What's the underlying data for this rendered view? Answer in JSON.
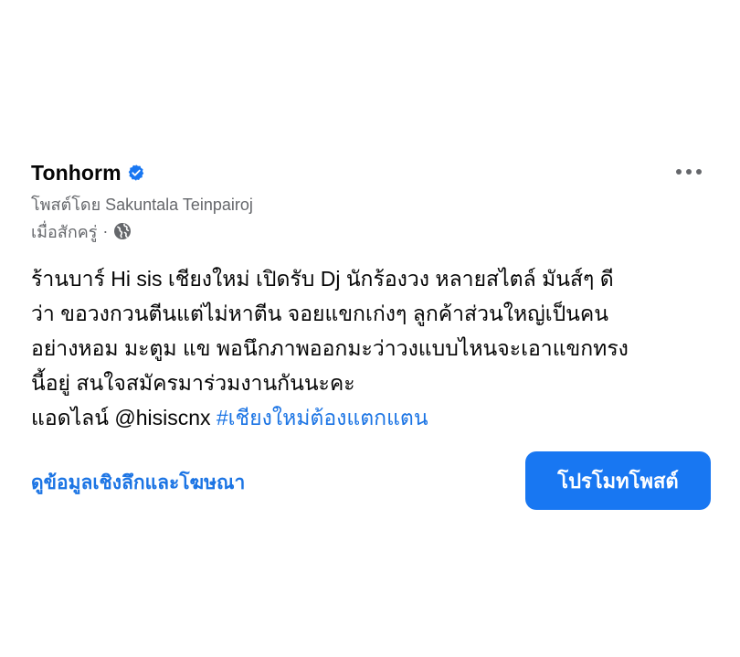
{
  "post": {
    "page_name": "Tonhorm",
    "byline": "โพสต์โดย Sakuntala Teinpairoj",
    "timestamp": "เมื่อสักครู่",
    "separator": "·",
    "body_lines": [
      "ร้านบาร์ Hi sis เชียงใหม่ เปิดรับ Dj  นักร้องวง หลายสไตล์ มันส์ๆ ดี",
      "ว่า  ขอวงกวนตีนแต่ไม่หาตีน จอยแขกเก่งๆ ลูกค้าส่วนใหญ่เป็นคน",
      "อย่างหอม มะตูม แข พอนึกภาพออกมะว่าวงแบบไหนจะเอาแขกทรง",
      "นี้อยู่ สนใจสมัครมาร่วมงานกันนะคะ"
    ],
    "contact_prefix": "แอดไลน์ @hisiscnx ",
    "hashtag": "#เชียงใหม่ต้องแตกแตน"
  },
  "footer": {
    "insights_label": "ดูข้อมูลเชิงลึกและโฆษณา",
    "promote_label": "โปรโมทโพสต์"
  },
  "icons": {
    "verified": "verified-badge-icon",
    "privacy": "globe-icon",
    "more": "more-horizontal-icon"
  },
  "colors": {
    "accent": "#1877f2",
    "link": "#1b74e4",
    "secondary_text": "#65676b",
    "primary_text": "#050505"
  }
}
